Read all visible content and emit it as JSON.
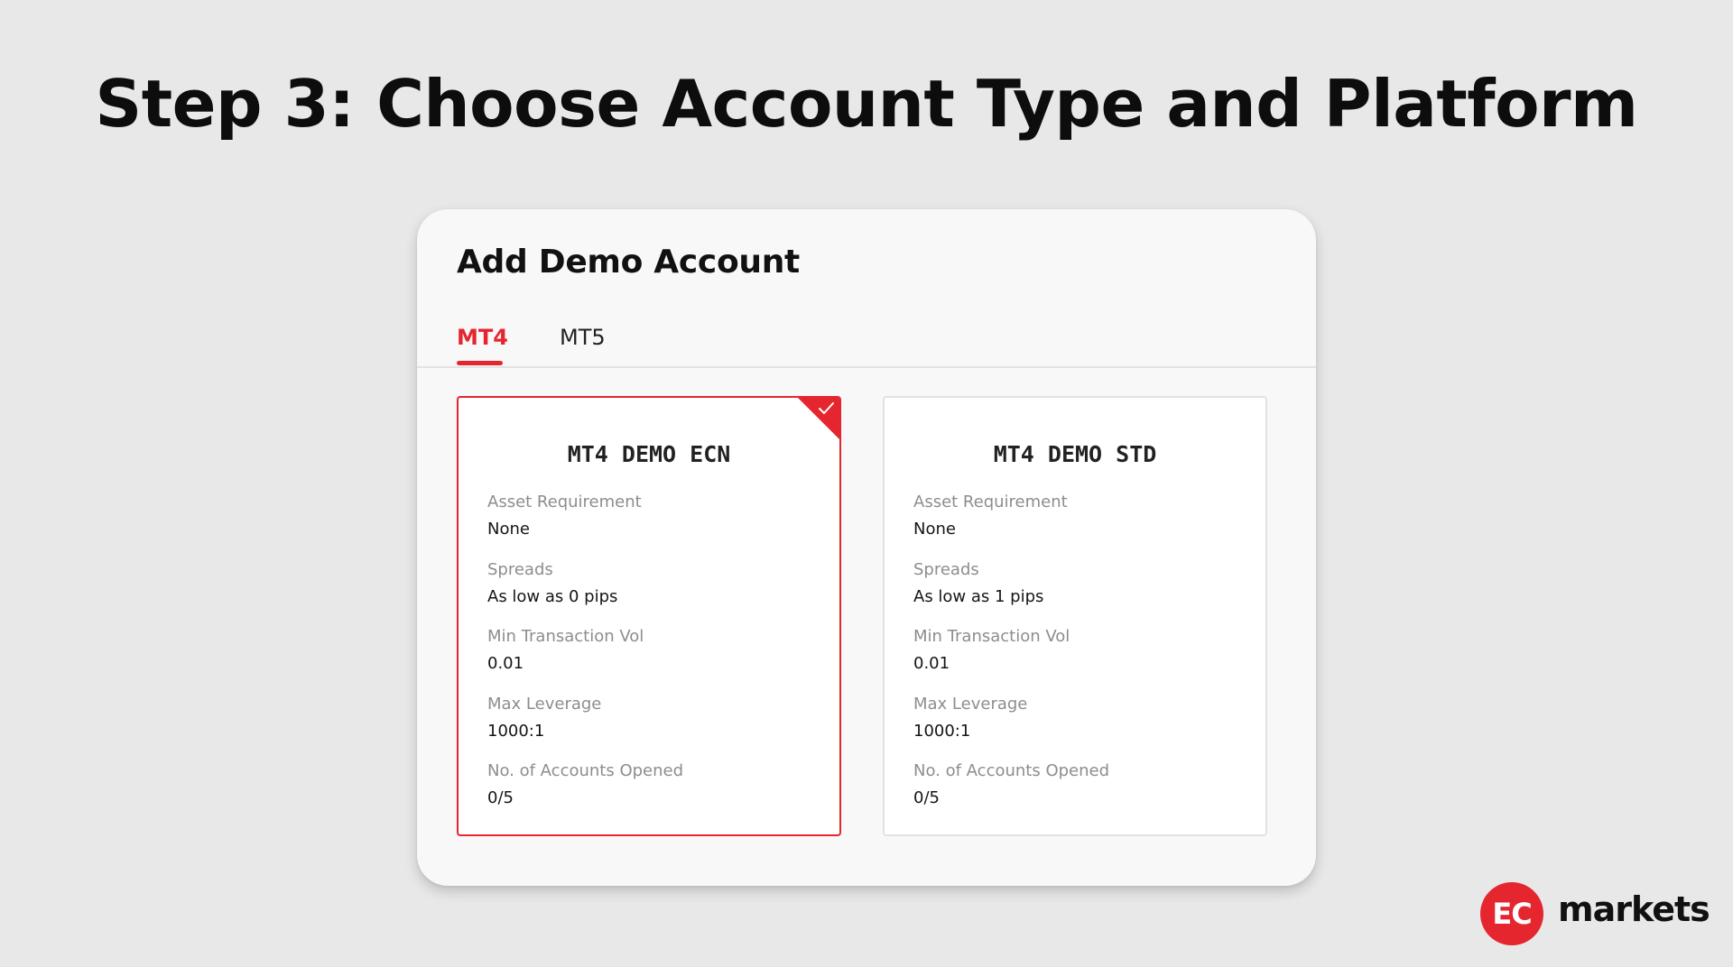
{
  "page": {
    "title": "Step 3: Choose Account Type and Platform"
  },
  "dialog": {
    "title": "Add Demo Account",
    "tabs": [
      {
        "label": "MT4",
        "active": true
      },
      {
        "label": "MT5",
        "active": false
      }
    ],
    "accounts": [
      {
        "title": "MT4 DEMO ECN",
        "selected": true,
        "fields": [
          {
            "label": "Asset Requirement",
            "value": "None"
          },
          {
            "label": "Spreads",
            "value": "As low as 0 pips"
          },
          {
            "label": "Min Transaction Vol",
            "value": "0.01"
          },
          {
            "label": "Max Leverage",
            "value": "1000:1"
          },
          {
            "label": "No. of Accounts Opened",
            "value": "0/5"
          }
        ]
      },
      {
        "title": "MT4 DEMO STD",
        "selected": false,
        "fields": [
          {
            "label": "Asset Requirement",
            "value": "None"
          },
          {
            "label": "Spreads",
            "value": "As low as 1 pips"
          },
          {
            "label": "Min Transaction Vol",
            "value": "0.01"
          },
          {
            "label": "Max Leverage",
            "value": "1000:1"
          },
          {
            "label": "No. of Accounts Opened",
            "value": "0/5"
          }
        ]
      }
    ]
  },
  "brand": {
    "logo_mark": "EC",
    "logo_word": "markets"
  },
  "colors": {
    "accent": "#e5262f",
    "background": "#e8e8e8",
    "card_border": "#e2e2e2",
    "label_gray": "#8d8d8d"
  },
  "icons": {
    "selected_check": "check-icon"
  }
}
